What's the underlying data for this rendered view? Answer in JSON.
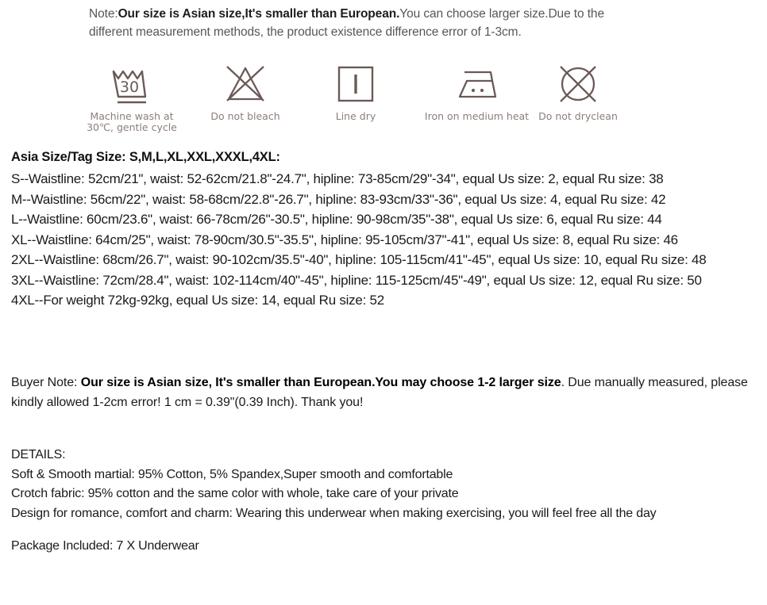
{
  "top_note": {
    "prefix": "Note:",
    "bold": "Our size is Asian size,It's smaller than European.",
    "suffix": "You can choose larger size.Due to the different measurement methods, the   product existence difference error of 1-3cm."
  },
  "care_symbols": [
    {
      "icon": "machine-wash-30-icon",
      "label": "Machine wash at\n30℃, gentle cycle"
    },
    {
      "icon": "do-not-bleach-icon",
      "label": "Do not bleach"
    },
    {
      "icon": "line-dry-icon",
      "label": "Line dry"
    },
    {
      "icon": "iron-medium-heat-icon",
      "label": "Iron on medium heat"
    },
    {
      "icon": "do-not-dryclean-icon",
      "label": "Do not dryclean"
    }
  ],
  "size_chart": {
    "heading": "Asia Size/Tag Size: S,M,L,XL,XXL,XXXL,4XL:",
    "lines": [
      "S--Waistline: 52cm/21\", waist: 52-62cm/21.8\"-24.7\", hipline: 73-85cm/29\"-34\", equal Us size: 2, equal Ru size: 38",
      "M--Waistline: 56cm/22\", waist: 58-68cm/22.8\"-26.7\", hipline: 83-93cm/33\"-36\", equal Us size: 4, equal Ru size: 42",
      "L--Waistline: 60cm/23.6\", waist: 66-78cm/26\"-30.5\", hipline: 90-98cm/35\"-38\", equal Us size: 6, equal Ru size: 44",
      "XL--Waistline: 64cm/25\", waist: 78-90cm/30.5\"-35.5\", hipline: 95-105cm/37\"-41\", equal Us size: 8, equal Ru size: 46",
      "2XL--Waistline: 68cm/26.7\", waist: 90-102cm/35.5\"-40\", hipline: 105-115cm/41\"-45\", equal Us size: 10, equal Ru size: 48",
      "3XL--Waistline: 72cm/28.4\", waist: 102-114cm/40\"-45\", hipline: 115-125cm/45\"-49\", equal Us size: 12, equal Ru size: 50",
      "4XL--For weight 72kg-92kg, equal Us size: 14, equal Ru size: 52"
    ]
  },
  "buyer_note": {
    "prefix": "Buyer Note: ",
    "bold": "Our size is Asian size, It's smaller than European.You may choose 1-2 larger size",
    "suffix": ". Due manually measured, please kindly allowed 1-2cm error! 1 cm = 0.39\"(0.39 Inch). Thank you!"
  },
  "details": {
    "heading": "DETAILS:",
    "lines": [
      "Soft & Smooth martial: 95% Cotton, 5% Spandex,Super smooth  and comfortable",
      "Crotch fabric: 95% cotton and the same color with whole, take care of your private",
      "Design for romance, comfort and charm: Wearing this underwear when making exercising, you will feel free all the day"
    ],
    "package": "Package Included: 7 X Underwear"
  },
  "colors": {
    "symbol_stroke": "#6b5a57",
    "symbol_label": "#8d7d79",
    "body_text": "#1a1a1a",
    "note_text": "#575757"
  }
}
